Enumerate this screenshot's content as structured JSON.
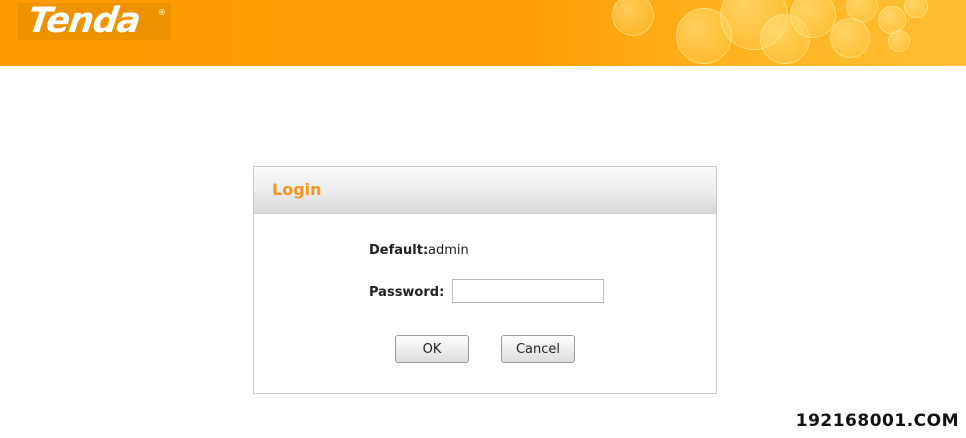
{
  "header": {
    "brand_logo": "Tenda",
    "brand_registered_mark": "®"
  },
  "login": {
    "title": "Login",
    "default_label": "Default:",
    "default_value": "admin",
    "password_label": "Password:",
    "password_value": "",
    "ok_label": "OK",
    "cancel_label": "Cancel"
  },
  "watermark": "192168001.COM",
  "colors": {
    "header_orange": "#ff9a00",
    "title_orange": "#f4941c",
    "logo_bg": "#ef9200"
  }
}
